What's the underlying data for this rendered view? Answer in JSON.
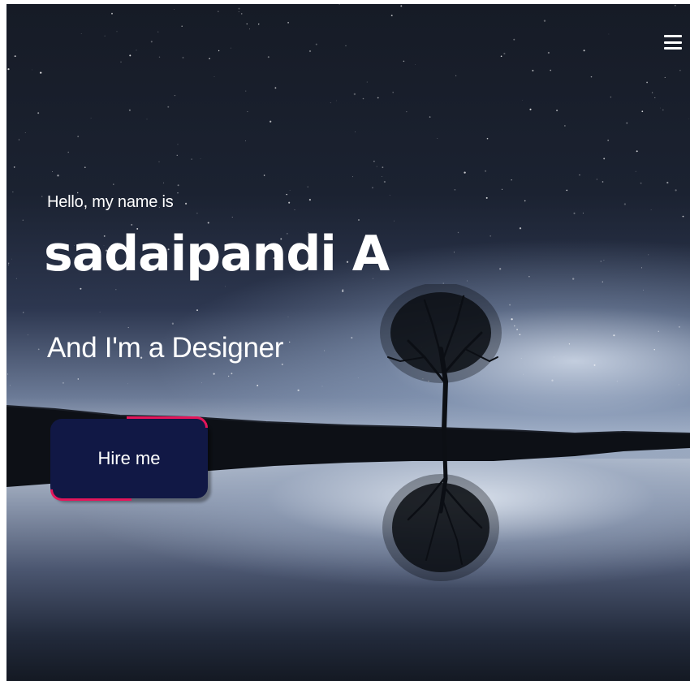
{
  "hero": {
    "greeting": "Hello, my name is",
    "name": "sadaipandi A",
    "subtitle": "And I'm a Designer",
    "cta_label": "Hire me"
  },
  "nav": {
    "menu_icon": "hamburger-menu-icon"
  },
  "colors": {
    "accent": "#e3165b",
    "button_bg": "#111845",
    "text": "#ffffff"
  }
}
